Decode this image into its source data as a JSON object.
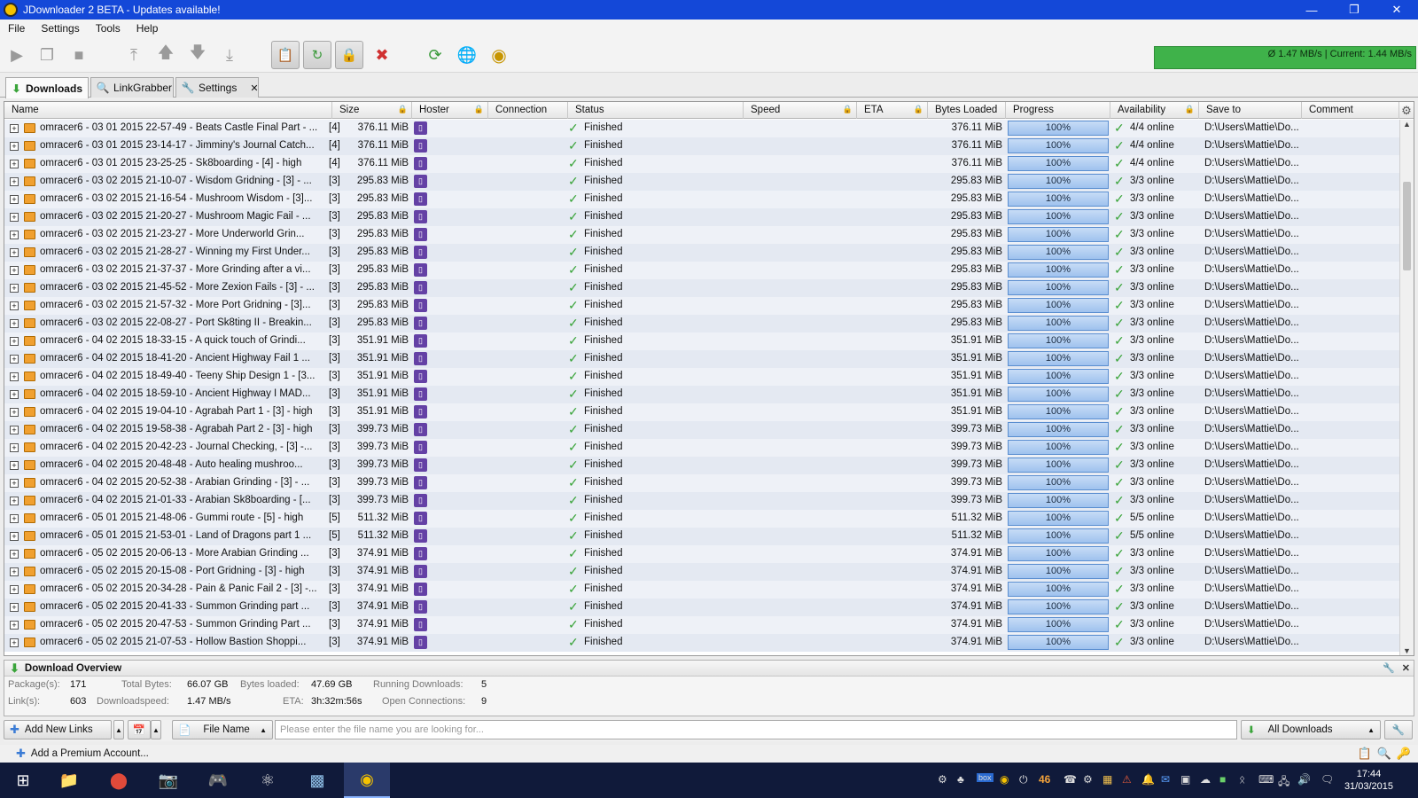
{
  "window": {
    "title": "JDownloader 2 BETA - Updates available!"
  },
  "menu": [
    "File",
    "Settings",
    "Tools",
    "Help"
  ],
  "toolbar_icons": [
    "play-icon",
    "stop-after-icon",
    "stop-icon",
    "move-top-icon",
    "move-up-icon",
    "move-down-icon",
    "move-bottom-icon",
    "clipboard-observer-icon",
    "reconnect-icon",
    "premium-icon",
    "delete-icon",
    "update-icon",
    "reconnect-globe-icon",
    "jd-logo-icon"
  ],
  "speed": {
    "text": "Ø 1.47 MB/s | Current: 1.44 MB/s"
  },
  "tabs": [
    {
      "label": "Downloads",
      "icon": "download-arrow-icon"
    },
    {
      "label": "LinkGrabber",
      "icon": "linkgrabber-icon"
    },
    {
      "label": "Settings",
      "icon": "wrench-icon",
      "close": "✕"
    }
  ],
  "columns": [
    "Name",
    "Size",
    "Hoster",
    "Connection",
    "Status",
    "Speed",
    "ETA",
    "Bytes Loaded",
    "Progress",
    "Availability",
    "Save to",
    "Comment"
  ],
  "rows": [
    {
      "name": "omracer6 - 03 01 2015 22-57-49 - Beats Castle Final Part - ...",
      "count": "[4]",
      "size": "376.11 MiB",
      "status": "Finished",
      "loaded": "376.11 MiB",
      "progress": "100%",
      "avail": "4/4 online",
      "save": "D:\\Users\\Mattie\\Do..."
    },
    {
      "name": "omracer6 - 03 01 2015 23-14-17 - Jimminy's Journal Catch...",
      "count": "[4]",
      "size": "376.11 MiB",
      "status": "Finished",
      "loaded": "376.11 MiB",
      "progress": "100%",
      "avail": "4/4 online",
      "save": "D:\\Users\\Mattie\\Do..."
    },
    {
      "name": "omracer6 - 03 01 2015 23-25-25 - Sk8boarding - [4] - high",
      "count": "[4]",
      "size": "376.11 MiB",
      "status": "Finished",
      "loaded": "376.11 MiB",
      "progress": "100%",
      "avail": "4/4 online",
      "save": "D:\\Users\\Mattie\\Do..."
    },
    {
      "name": "omracer6 - 03 02 2015 21-10-07 - Wisdom Gridning - [3] - ...",
      "count": "[3]",
      "size": "295.83 MiB",
      "status": "Finished",
      "loaded": "295.83 MiB",
      "progress": "100%",
      "avail": "3/3 online",
      "save": "D:\\Users\\Mattie\\Do..."
    },
    {
      "name": "omracer6 - 03 02 2015 21-16-54 - Mushroom Wisdom - [3]...",
      "count": "[3]",
      "size": "295.83 MiB",
      "status": "Finished",
      "loaded": "295.83 MiB",
      "progress": "100%",
      "avail": "3/3 online",
      "save": "D:\\Users\\Mattie\\Do..."
    },
    {
      "name": "omracer6 - 03 02 2015 21-20-27 - Mushroom Magic Fail - ...",
      "count": "[3]",
      "size": "295.83 MiB",
      "status": "Finished",
      "loaded": "295.83 MiB",
      "progress": "100%",
      "avail": "3/3 online",
      "save": "D:\\Users\\Mattie\\Do..."
    },
    {
      "name": "omracer6 - 03 02 2015 21-23-27 - More Underworld Grin...",
      "count": "[3]",
      "size": "295.83 MiB",
      "status": "Finished",
      "loaded": "295.83 MiB",
      "progress": "100%",
      "avail": "3/3 online",
      "save": "D:\\Users\\Mattie\\Do..."
    },
    {
      "name": "omracer6 - 03 02 2015 21-28-27 - Winning my First Under...",
      "count": "[3]",
      "size": "295.83 MiB",
      "status": "Finished",
      "loaded": "295.83 MiB",
      "progress": "100%",
      "avail": "3/3 online",
      "save": "D:\\Users\\Mattie\\Do..."
    },
    {
      "name": "omracer6 - 03 02 2015 21-37-37 - More Grinding after a vi...",
      "count": "[3]",
      "size": "295.83 MiB",
      "status": "Finished",
      "loaded": "295.83 MiB",
      "progress": "100%",
      "avail": "3/3 online",
      "save": "D:\\Users\\Mattie\\Do..."
    },
    {
      "name": "omracer6 - 03 02 2015 21-45-52 - More Zexion Fails - [3] - ...",
      "count": "[3]",
      "size": "295.83 MiB",
      "status": "Finished",
      "loaded": "295.83 MiB",
      "progress": "100%",
      "avail": "3/3 online",
      "save": "D:\\Users\\Mattie\\Do..."
    },
    {
      "name": "omracer6 - 03 02 2015 21-57-32 - More Port Gridning - [3]...",
      "count": "[3]",
      "size": "295.83 MiB",
      "status": "Finished",
      "loaded": "295.83 MiB",
      "progress": "100%",
      "avail": "3/3 online",
      "save": "D:\\Users\\Mattie\\Do..."
    },
    {
      "name": "omracer6 - 03 02 2015 22-08-27 - Port Sk8ting II  - Breakin...",
      "count": "[3]",
      "size": "295.83 MiB",
      "status": "Finished",
      "loaded": "295.83 MiB",
      "progress": "100%",
      "avail": "3/3 online",
      "save": "D:\\Users\\Mattie\\Do..."
    },
    {
      "name": "omracer6 - 04 02 2015 18-33-15 - A quick touch of Grindi...",
      "count": "[3]",
      "size": "351.91 MiB",
      "status": "Finished",
      "loaded": "351.91 MiB",
      "progress": "100%",
      "avail": "3/3 online",
      "save": "D:\\Users\\Mattie\\Do..."
    },
    {
      "name": "omracer6 - 04 02 2015 18-41-20 - Ancient Highway Fail 1 ...",
      "count": "[3]",
      "size": "351.91 MiB",
      "status": "Finished",
      "loaded": "351.91 MiB",
      "progress": "100%",
      "avail": "3/3 online",
      "save": "D:\\Users\\Mattie\\Do..."
    },
    {
      "name": "omracer6 - 04 02 2015 18-49-40 - Teeny Ship Design 1 - [3...",
      "count": "[3]",
      "size": "351.91 MiB",
      "status": "Finished",
      "loaded": "351.91 MiB",
      "progress": "100%",
      "avail": "3/3 online",
      "save": "D:\\Users\\Mattie\\Do..."
    },
    {
      "name": "omracer6 - 04 02 2015 18-59-10 - Ancient Highway I MAD...",
      "count": "[3]",
      "size": "351.91 MiB",
      "status": "Finished",
      "loaded": "351.91 MiB",
      "progress": "100%",
      "avail": "3/3 online",
      "save": "D:\\Users\\Mattie\\Do..."
    },
    {
      "name": "omracer6 - 04 02 2015 19-04-10 - Agrabah Part 1 - [3] - high",
      "count": "[3]",
      "size": "351.91 MiB",
      "status": "Finished",
      "loaded": "351.91 MiB",
      "progress": "100%",
      "avail": "3/3 online",
      "save": "D:\\Users\\Mattie\\Do..."
    },
    {
      "name": "omracer6 - 04 02 2015 19-58-38 - Agrabah Part 2 - [3] - high",
      "count": "[3]",
      "size": "399.73 MiB",
      "status": "Finished",
      "loaded": "399.73 MiB",
      "progress": "100%",
      "avail": "3/3 online",
      "save": "D:\\Users\\Mattie\\Do..."
    },
    {
      "name": "omracer6 - 04 02 2015 20-42-23 - Journal Checking, - [3] -...",
      "count": "[3]",
      "size": "399.73 MiB",
      "status": "Finished",
      "loaded": "399.73 MiB",
      "progress": "100%",
      "avail": "3/3 online",
      "save": "D:\\Users\\Mattie\\Do..."
    },
    {
      "name": "omracer6 - 04 02 2015 20-48-48 - Auto healing mushroo...",
      "count": "[3]",
      "size": "399.73 MiB",
      "status": "Finished",
      "loaded": "399.73 MiB",
      "progress": "100%",
      "avail": "3/3 online",
      "save": "D:\\Users\\Mattie\\Do..."
    },
    {
      "name": "omracer6 - 04 02 2015 20-52-38 - Arabian Grinding - [3] - ...",
      "count": "[3]",
      "size": "399.73 MiB",
      "status": "Finished",
      "loaded": "399.73 MiB",
      "progress": "100%",
      "avail": "3/3 online",
      "save": "D:\\Users\\Mattie\\Do..."
    },
    {
      "name": "omracer6 - 04 02 2015 21-01-33 - Arabian Sk8boarding - [...",
      "count": "[3]",
      "size": "399.73 MiB",
      "status": "Finished",
      "loaded": "399.73 MiB",
      "progress": "100%",
      "avail": "3/3 online",
      "save": "D:\\Users\\Mattie\\Do..."
    },
    {
      "name": "omracer6 - 05 01 2015 21-48-06 - Gummi route - [5] - high",
      "count": "[5]",
      "size": "511.32 MiB",
      "status": "Finished",
      "loaded": "511.32 MiB",
      "progress": "100%",
      "avail": "5/5 online",
      "save": "D:\\Users\\Mattie\\Do..."
    },
    {
      "name": "omracer6 - 05 01 2015 21-53-01 - Land of Dragons part 1 ...",
      "count": "[5]",
      "size": "511.32 MiB",
      "status": "Finished",
      "loaded": "511.32 MiB",
      "progress": "100%",
      "avail": "5/5 online",
      "save": "D:\\Users\\Mattie\\Do..."
    },
    {
      "name": "omracer6 - 05 02 2015 20-06-13 - More Arabian Grinding ...",
      "count": "[3]",
      "size": "374.91 MiB",
      "status": "Finished",
      "loaded": "374.91 MiB",
      "progress": "100%",
      "avail": "3/3 online",
      "save": "D:\\Users\\Mattie\\Do..."
    },
    {
      "name": "omracer6 - 05 02 2015 20-15-08 - Port Gridning - [3] - high",
      "count": "[3]",
      "size": "374.91 MiB",
      "status": "Finished",
      "loaded": "374.91 MiB",
      "progress": "100%",
      "avail": "3/3 online",
      "save": "D:\\Users\\Mattie\\Do..."
    },
    {
      "name": "omracer6 - 05 02 2015 20-34-28 - Pain & Panic Fail 2 - [3] -...",
      "count": "[3]",
      "size": "374.91 MiB",
      "status": "Finished",
      "loaded": "374.91 MiB",
      "progress": "100%",
      "avail": "3/3 online",
      "save": "D:\\Users\\Mattie\\Do..."
    },
    {
      "name": "omracer6 - 05 02 2015 20-41-33 - Summon Grinding part ...",
      "count": "[3]",
      "size": "374.91 MiB",
      "status": "Finished",
      "loaded": "374.91 MiB",
      "progress": "100%",
      "avail": "3/3 online",
      "save": "D:\\Users\\Mattie\\Do..."
    },
    {
      "name": "omracer6 - 05 02 2015 20-47-53 - Summon Grinding Part ...",
      "count": "[3]",
      "size": "374.91 MiB",
      "status": "Finished",
      "loaded": "374.91 MiB",
      "progress": "100%",
      "avail": "3/3 online",
      "save": "D:\\Users\\Mattie\\Do..."
    },
    {
      "name": "omracer6 - 05 02 2015 21-07-53 - Hollow Bastion Shoppi...",
      "count": "[3]",
      "size": "374.91 MiB",
      "status": "Finished",
      "loaded": "374.91 MiB",
      "progress": "100%",
      "avail": "3/3 online",
      "save": "D:\\Users\\Mattie\\Do..."
    }
  ],
  "overview": {
    "title": "Download Overview",
    "packages_label": "Package(s):",
    "packages": "171",
    "links_label": "Link(s):",
    "links": "603",
    "total_label": "Total Bytes:",
    "total": "66.07 GB",
    "speed_label": "Downloadspeed:",
    "speed": "1.47 MB/s",
    "loaded_label": "Bytes loaded:",
    "loaded": "47.69 GB",
    "eta_label": "ETA:",
    "eta": "3h:32m:56s",
    "running_label": "Running Downloads:",
    "running": "5",
    "conn_label": "Open Connections:",
    "conn": "9"
  },
  "searchbar": {
    "add_links": "Add New Links",
    "filter": "File Name",
    "placeholder": "Please enter the file name you are looking for...",
    "all_downloads": "All Downloads"
  },
  "status": {
    "add_premium": "Add a Premium Account..."
  },
  "taskbar": {
    "apps": [
      "windows-start-icon",
      "file-explorer-icon",
      "chrome-icon",
      "instagram-icon",
      "game-icon",
      "obs-icon",
      "media-icon",
      "jdownloader-icon"
    ],
    "tray_badge": "46",
    "tray_box": "box",
    "time": "17:44",
    "date": "31/03/2015"
  }
}
